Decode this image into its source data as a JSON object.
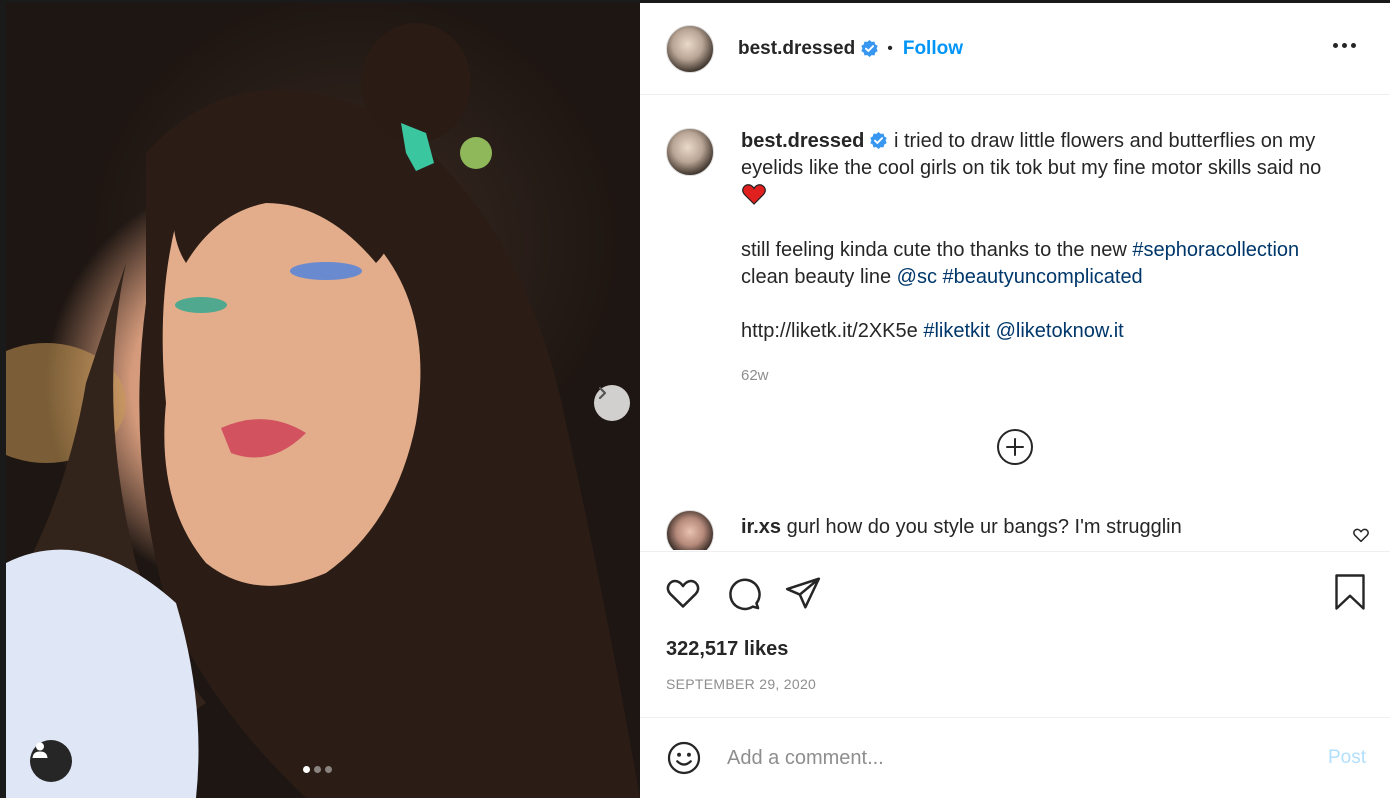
{
  "post": {
    "username": "best.dressed",
    "follow_label": "Follow",
    "separator": "•",
    "caption_line1": "i tried to draw little flowers and butterflies on my eyelids like the cool girls on tik tok but my fine motor skills said no",
    "caption_p2_text": "still feeling kinda cute tho thanks to the new ",
    "caption_p2_tag1": "#sephoracollection",
    "caption_p2_text2": "clean beauty line ",
    "caption_p2_mention": "@sc",
    "caption_p2_tag2": "#beautyuncomplicated",
    "caption_p3_url": "http://liketk.it/2XK5e",
    "caption_p3_tag": "#liketkit",
    "caption_p3_mention": "@liketoknow.it",
    "time_ago": "62w",
    "likes": "322,517 likes",
    "date": "SEPTEMBER 29, 2020"
  },
  "comments": [
    {
      "username": "ir.xs",
      "text": "gurl how do you style ur bangs? I'm strugglin"
    }
  ],
  "composer": {
    "placeholder": "Add a comment...",
    "post_label": "Post"
  },
  "carousel": {
    "count": 3,
    "active": 1
  },
  "icons": {
    "verified": "verified-badge-icon",
    "more": "more-options-icon",
    "load_more": "load-more-comments-icon",
    "like": "heart-icon",
    "comment": "comment-bubble-icon",
    "share": "paper-plane-icon",
    "save": "bookmark-icon",
    "emoji": "smiley-face-icon",
    "next": "chevron-right-icon",
    "tag": "person-tag-icon"
  },
  "colors": {
    "accent": "#0095f6",
    "link": "#00376b",
    "muted": "#8e8e8e",
    "post_disabled": "#b2dffc",
    "emoji_heart": "#e0201f"
  }
}
